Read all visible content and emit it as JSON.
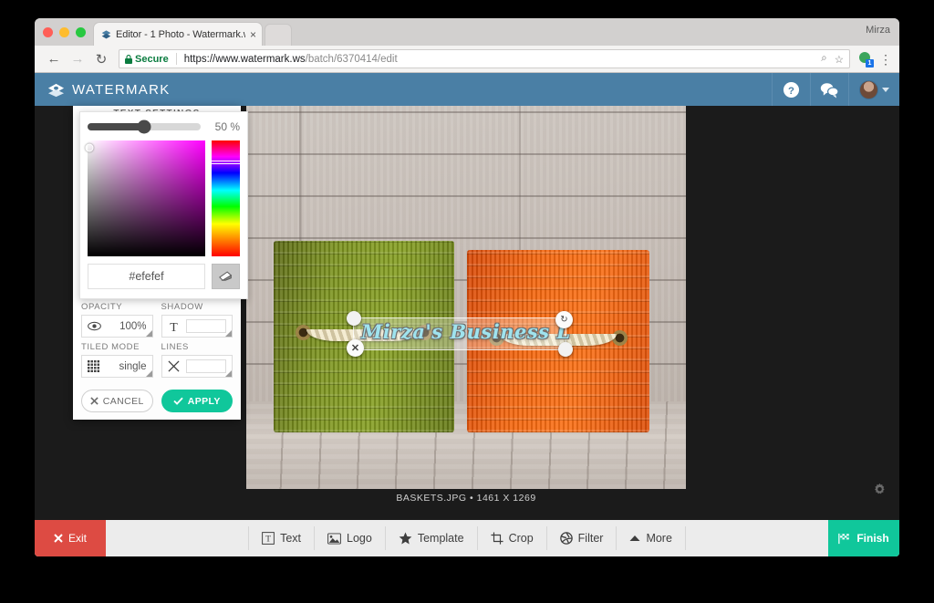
{
  "window": {
    "user_label": "Mirza",
    "tab": {
      "title": "Editor - 1 Photo - Watermark.w",
      "close_label": "×"
    },
    "browser": {
      "back_label": "←",
      "forward_label": "→",
      "reload_label": "↻",
      "secure_label": "Secure",
      "url_scheme": "https://www.watermark.ws",
      "url_path": "/batch/6370414/edit",
      "zoom_icon_label": "⌕",
      "bookmark_icon_label": "☆",
      "extension_count": "1",
      "menu_label": "⋮"
    }
  },
  "app_header": {
    "brand": "WATERMARK",
    "help_title": "Help",
    "chat_title": "Chat",
    "account_title": "Account"
  },
  "panel": {
    "title": "TEXT SETTINGS",
    "color_picker": {
      "slider_value": "50 %",
      "slider_percent": 50,
      "hex": "#efefef",
      "eraser_title": "Reset color"
    },
    "fields": [
      {
        "label": "OPACITY",
        "value": "100%",
        "icon": "eye-icon"
      },
      {
        "label": "SHADOW",
        "value": "",
        "icon": "text-shadow-icon"
      },
      {
        "label": "TILED MODE",
        "value": "single",
        "icon": "grid-icon"
      },
      {
        "label": "LINES",
        "value": "",
        "icon": "close-x-icon"
      }
    ],
    "cancel_label": "CANCEL",
    "apply_label": "APPLY"
  },
  "canvas": {
    "watermark_text": "Mirza's Business L",
    "caption": "BASKETS.JPG • 1461 X 1269",
    "handles": {
      "close_label": "✕",
      "rotate_label": "↻"
    },
    "settings_title": "Settings"
  },
  "bottom_bar": {
    "exit_label": "Exit",
    "finish_label": "Finish",
    "tools": [
      {
        "label": "Text",
        "icon": "text-icon"
      },
      {
        "label": "Logo",
        "icon": "image-icon"
      },
      {
        "label": "Template",
        "icon": "star-icon"
      },
      {
        "label": "Crop",
        "icon": "crop-icon"
      },
      {
        "label": "Filter",
        "icon": "aperture-icon"
      },
      {
        "label": "More",
        "icon": "caret-up-icon"
      }
    ]
  },
  "colors": {
    "accent_teal": "#10c79b",
    "exit_red": "#dd4b43",
    "header_blue": "#4a7fa5",
    "watermark_text": "#9fe3ee",
    "picker_hex": "#efefef"
  }
}
